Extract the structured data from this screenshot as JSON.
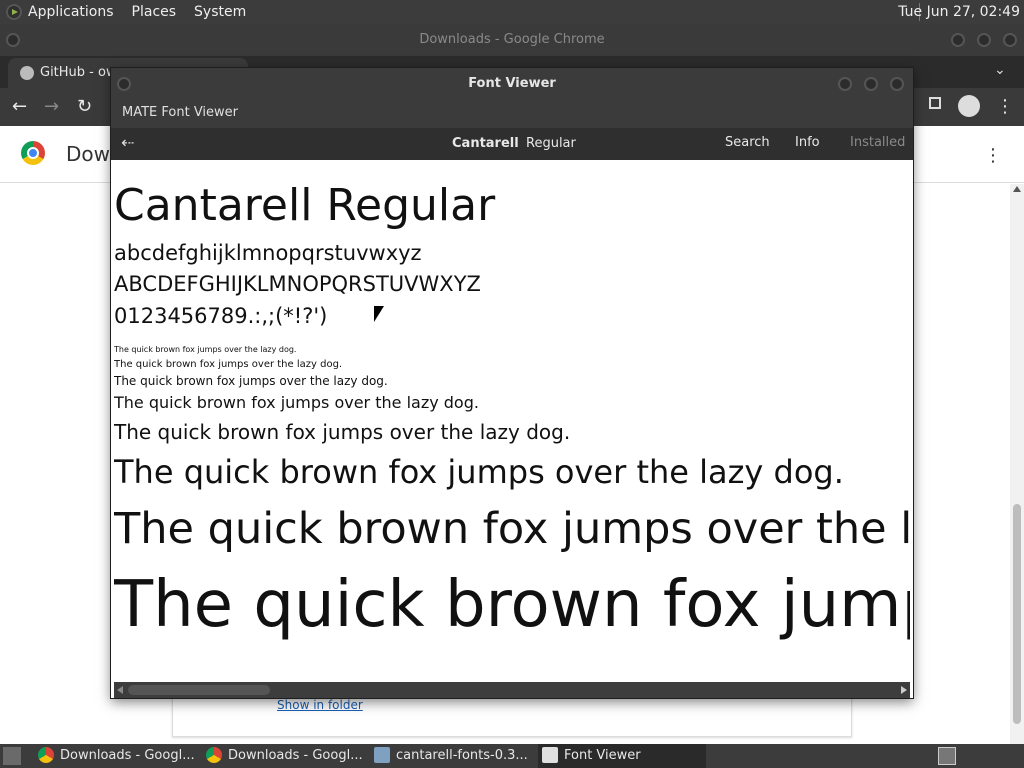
{
  "top_panel": {
    "menus": [
      "Applications",
      "Places",
      "System"
    ],
    "clock": "Tue Jun 27, 02:49"
  },
  "chrome": {
    "window_title": "Downloads - Google Chrome",
    "tab_label": "GitHub - ow",
    "page_title": "Dow",
    "show_in_folder": "Show in folder"
  },
  "font_viewer": {
    "window_title": "Font Viewer",
    "app_name": "MATE Font Viewer",
    "font_family": "Cantarell",
    "font_style": "Regular",
    "search_label": "Search",
    "info_label": "Info",
    "installed_label": "Installed",
    "preview": {
      "heading": "Cantarell Regular",
      "lowercase": "abcdefghijklmnopqrstuvwxyz",
      "uppercase": "ABCDEFGHIJKLMNOPQRSTUVWXYZ",
      "digits": "0123456789.:,;(*!?')",
      "sample": "The quick brown fox jumps over the lazy dog."
    }
  },
  "taskbar": {
    "items": [
      {
        "label": "Downloads - Googl...",
        "icon": "chrome-icon"
      },
      {
        "label": "Downloads - Googl...",
        "icon": "chrome-icon"
      },
      {
        "label": "cantarell-fonts-0.3...",
        "icon": "archive-icon"
      },
      {
        "label": "Font Viewer",
        "icon": "font-viewer-icon"
      }
    ]
  }
}
